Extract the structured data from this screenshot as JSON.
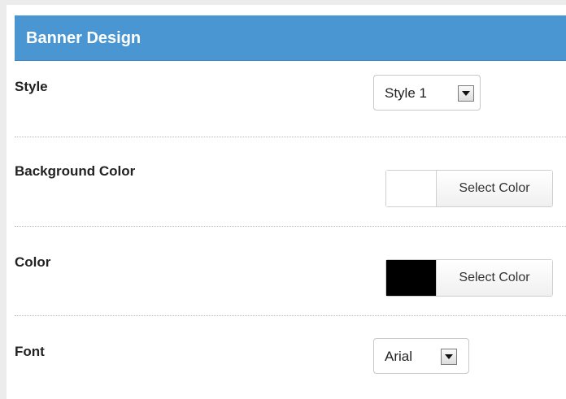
{
  "panel": {
    "title": "Banner Design"
  },
  "fields": {
    "style": {
      "label": "Style",
      "value": "Style 1"
    },
    "background_color": {
      "label": "Background Color",
      "swatch_color": "#ffffff",
      "button_label": "Select Color"
    },
    "color": {
      "label": "Color",
      "swatch_color": "#000000",
      "button_label": "Select Color"
    },
    "font": {
      "label": "Font",
      "value": "Arial"
    }
  },
  "colors": {
    "header_bg": "#4a96d2",
    "header_text": "#ffffff"
  },
  "icons": {
    "dropdown": "chevron-down-icon"
  }
}
